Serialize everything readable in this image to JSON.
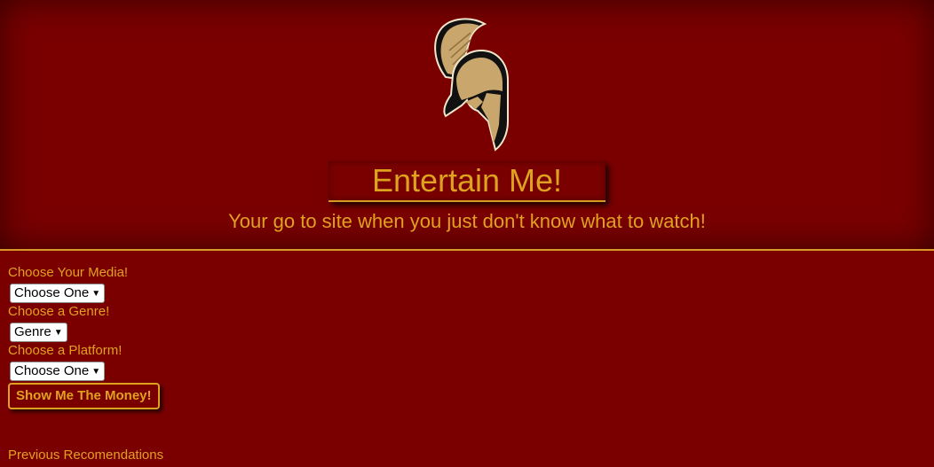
{
  "header": {
    "logo_icon": "spartan-helmet-icon",
    "title": "Entertain Me!",
    "subtitle": "Your go to site when you just don't know what to watch!"
  },
  "form": {
    "media_label": "Choose Your Media!",
    "media_value": "Choose One",
    "genre_label": "Choose a Genre!",
    "genre_value": "Genre",
    "platform_label": "Choose a Platform!",
    "platform_value": "Choose One",
    "submit_label": "Show Me The Money!"
  },
  "previous": {
    "label": "Previous Recomendations"
  },
  "colors": {
    "background": "#7a0000",
    "accent": "#e0a11f",
    "helmet_gold": "#c9a66b",
    "helmet_dark": "#111111"
  }
}
